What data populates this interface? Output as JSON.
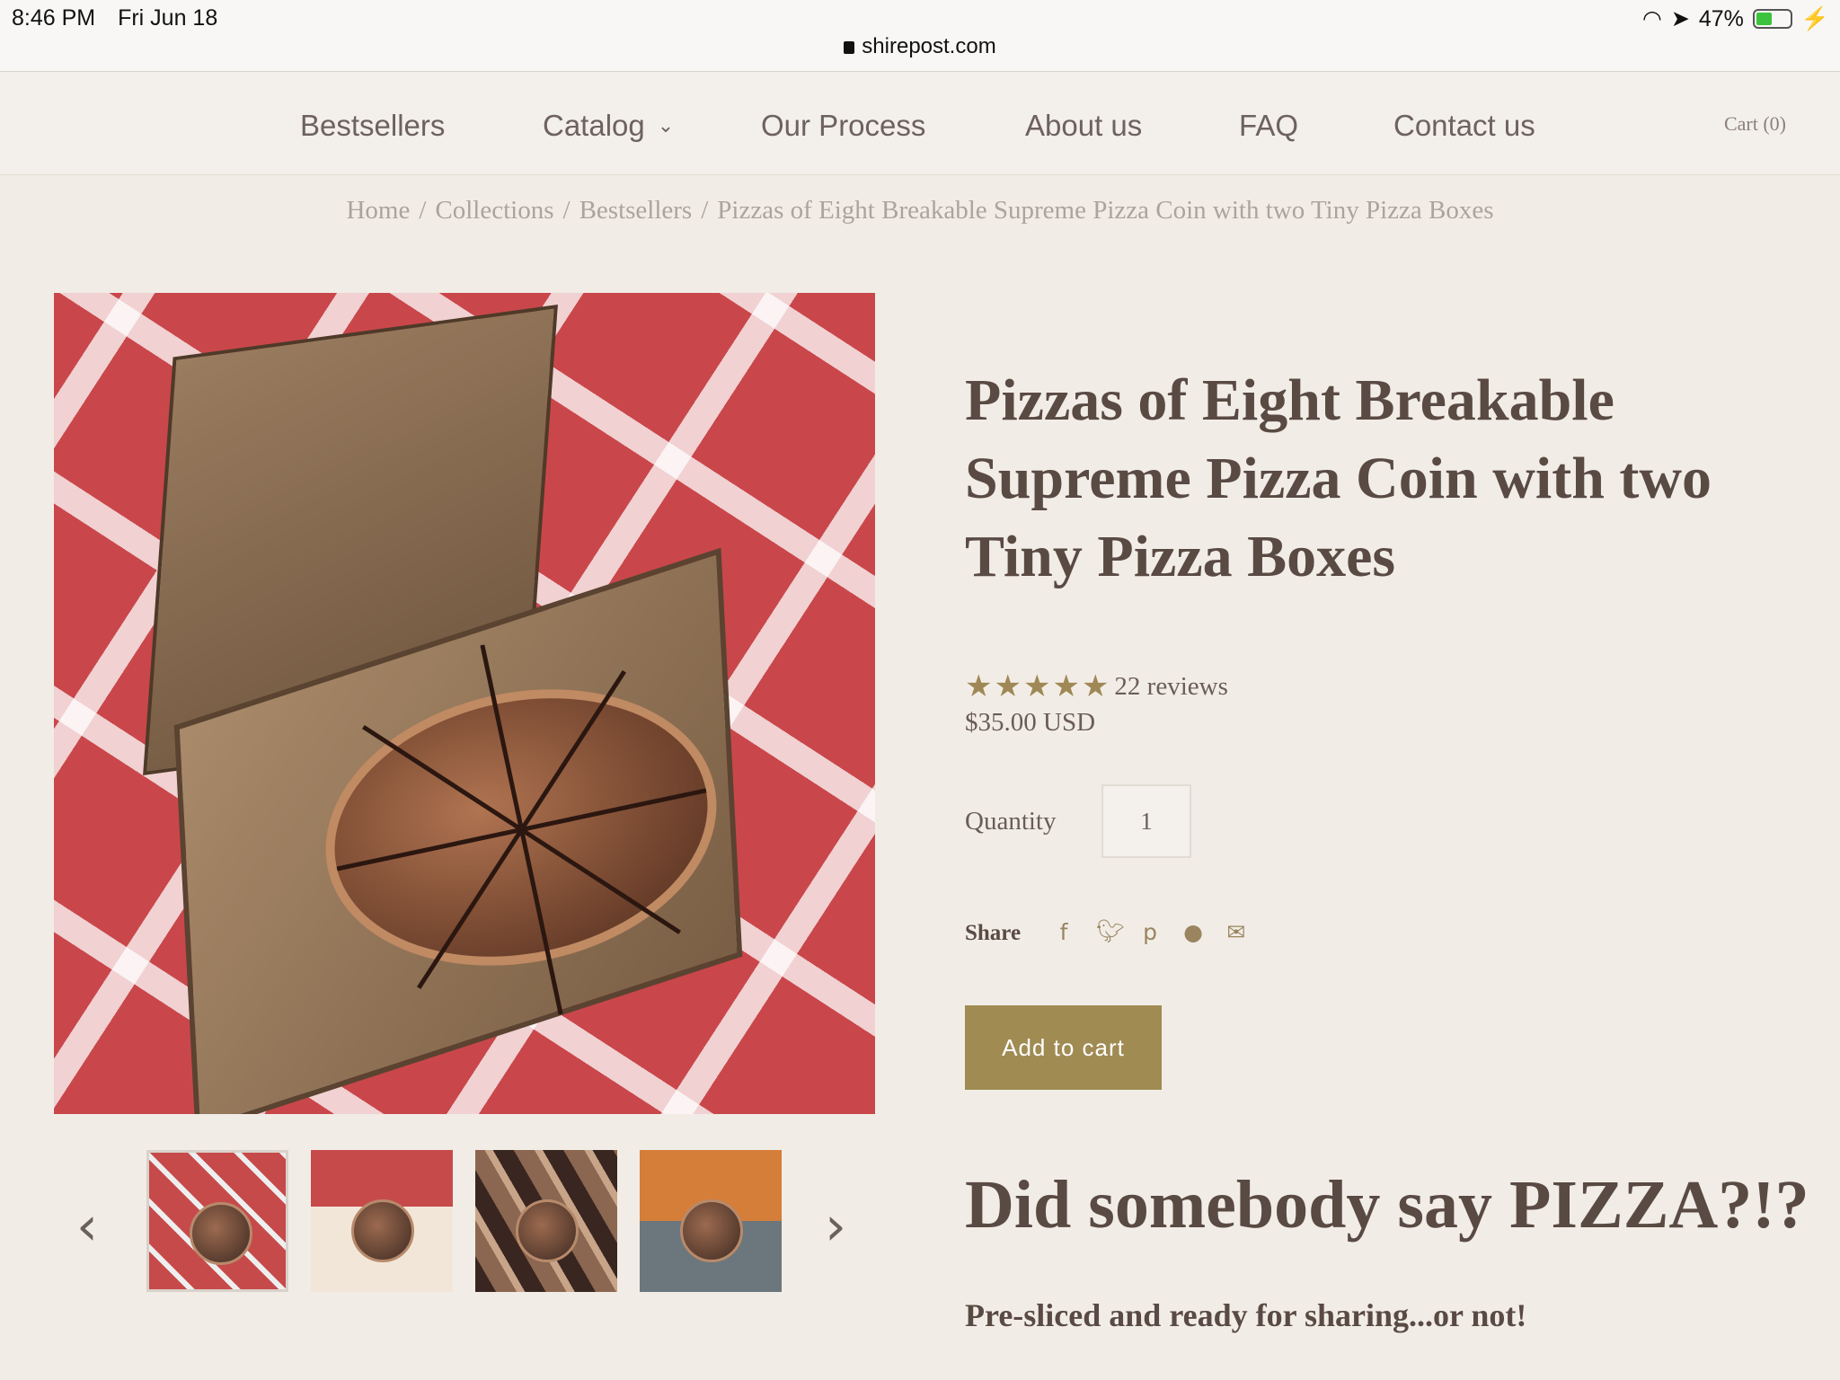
{
  "status_bar": {
    "time": "8:46 PM",
    "date": "Fri Jun 18",
    "battery": "47%",
    "battery_level": 0.47,
    "url": "shirepost.com"
  },
  "nav": {
    "items": [
      {
        "label": "Bestsellers"
      },
      {
        "label": "Catalog"
      },
      {
        "label": "Our Process"
      },
      {
        "label": "About us"
      },
      {
        "label": "FAQ"
      },
      {
        "label": "Contact us"
      }
    ],
    "cart": "Cart (0)"
  },
  "breadcrumb": [
    "Home",
    "Collections",
    "Bestsellers",
    "Pizzas of Eight Breakable Supreme Pizza Coin with two Tiny Pizza Boxes"
  ],
  "product": {
    "title": "Pizzas of Eight Breakable Supreme Pizza Coin with two Tiny Pizza Boxes",
    "rating": 5,
    "reviews": "22 reviews",
    "price": "$35.00 USD",
    "quantity_label": "Quantity",
    "quantity_value": "1",
    "share_label": "Share",
    "share_icons": [
      "facebook-icon",
      "twitter-icon",
      "pinterest-icon",
      "fancy-icon",
      "email-icon"
    ],
    "add_to_cart": "Add to cart"
  },
  "gallery": {
    "thumbnail_count": 4,
    "active_index": 0
  },
  "description": {
    "heading": "Did somebody say PIZZA?!?",
    "tagline": "Pre-sliced and ready for sharing...or not!"
  },
  "colors": {
    "accent": "#a08b53",
    "text": "#5a4a44",
    "background": "#f1ede6"
  }
}
